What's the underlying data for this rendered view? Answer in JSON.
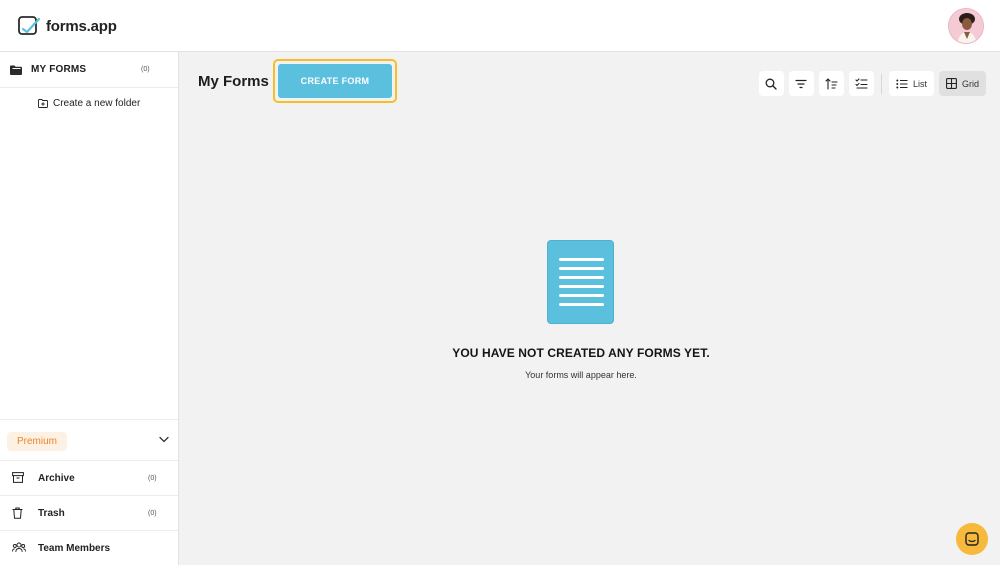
{
  "app": {
    "logo_text": "forms.app"
  },
  "sidebar": {
    "my_forms": {
      "label": "MY FORMS",
      "count": "(0)"
    },
    "new_folder_label": "Create a new folder",
    "premium_label": "Premium",
    "items": [
      {
        "label": "Archive",
        "count": "(0)",
        "icon": "archive-icon"
      },
      {
        "label": "Trash",
        "count": "(0)",
        "icon": "trash-icon"
      },
      {
        "label": "Team Members",
        "count": "",
        "icon": "team-icon"
      }
    ]
  },
  "main": {
    "title": "My Forms",
    "create_button": "CREATE FORM",
    "toolbar": {
      "icons": [
        "search-icon",
        "filter-icon",
        "sort-icon",
        "checklist-icon"
      ],
      "list_label": "List",
      "grid_label": "Grid",
      "active_view": "Grid"
    },
    "empty_state": {
      "title": "YOU HAVE NOT CREATED ANY FORMS YET.",
      "subtitle": "Your forms will appear here."
    }
  },
  "colors": {
    "accent": "#5bc0de",
    "highlight_border": "#f5bf2a",
    "premium_text": "#e9862c",
    "chat_button": "#f6b93b"
  }
}
